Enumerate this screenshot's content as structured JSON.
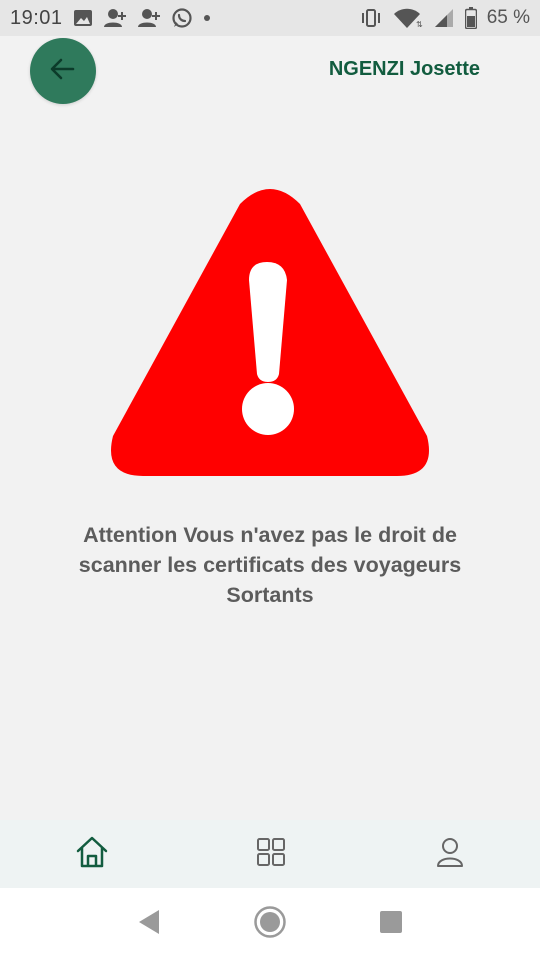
{
  "status_bar": {
    "time": "19:01",
    "battery_percent": "65 %",
    "left_icons": [
      "image-icon",
      "person-add-icon",
      "person-add-icon",
      "whatsapp-icon",
      "dot-icon"
    ],
    "right_icons": [
      "vibrate-icon",
      "wifi-icon",
      "signal-icon",
      "battery-icon"
    ]
  },
  "header": {
    "back_icon": "arrow-left-icon",
    "user_name": "NGENZI Josette",
    "accent_color": "#2f7a5c",
    "name_color": "#125c3f"
  },
  "main": {
    "warning_icon": "warning-triangle-icon",
    "warning_color": "#ff0000",
    "message": "Attention Vous n'avez pas le droit de scanner les certificats des voyageurs Sortants"
  },
  "bottom_nav": {
    "items": [
      {
        "name": "home",
        "icon": "home-icon",
        "active": true
      },
      {
        "name": "grid",
        "icon": "grid-icon",
        "active": false
      },
      {
        "name": "profile",
        "icon": "person-icon",
        "active": false
      }
    ]
  },
  "system_nav": {
    "items": [
      "back-triangle-icon",
      "home-circle-icon",
      "recents-square-icon"
    ]
  }
}
